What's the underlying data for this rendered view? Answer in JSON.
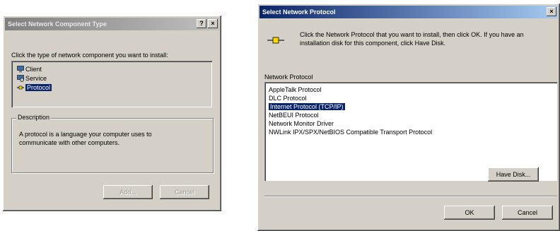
{
  "left_dialog": {
    "title": "Select Network Component Type",
    "help_btn": "?",
    "close_btn": "×",
    "instruction": "Click the type of network component you want to install:",
    "components": [
      {
        "label": "Client",
        "icon": "client-icon",
        "selected": false
      },
      {
        "label": "Service",
        "icon": "service-icon",
        "selected": false
      },
      {
        "label": "Protocol",
        "icon": "protocol-icon",
        "selected": true
      }
    ],
    "description_heading": "Description",
    "description_text": "A protocol is a language your computer uses to communicate with other computers.",
    "add_button": "Add...",
    "cancel_button": "Cancel"
  },
  "right_dialog": {
    "title": "Select Network Protocol",
    "close_btn": "×",
    "instruction": "Click the Network Protocol that you want to install, then click OK. If you have an installation disk for this component, click Have Disk.",
    "list_label": "Network Protocol",
    "protocols": [
      {
        "label": "AppleTalk Protocol",
        "selected": false
      },
      {
        "label": "DLC Protocol",
        "selected": false
      },
      {
        "label": "Internet Protocol (TCP/IP)",
        "selected": true
      },
      {
        "label": "NetBEUI Protocol",
        "selected": false
      },
      {
        "label": "Network Monitor Driver",
        "selected": false
      },
      {
        "label": "NWLink IPX/SPX/NetBIOS Compatible Transport Protocol",
        "selected": false
      }
    ],
    "have_disk_button": "Have Disk...",
    "ok_button": "OK",
    "cancel_button": "Cancel"
  },
  "colors": {
    "selection": "#0a246a",
    "dialog_bg": "#d4d0c8"
  }
}
